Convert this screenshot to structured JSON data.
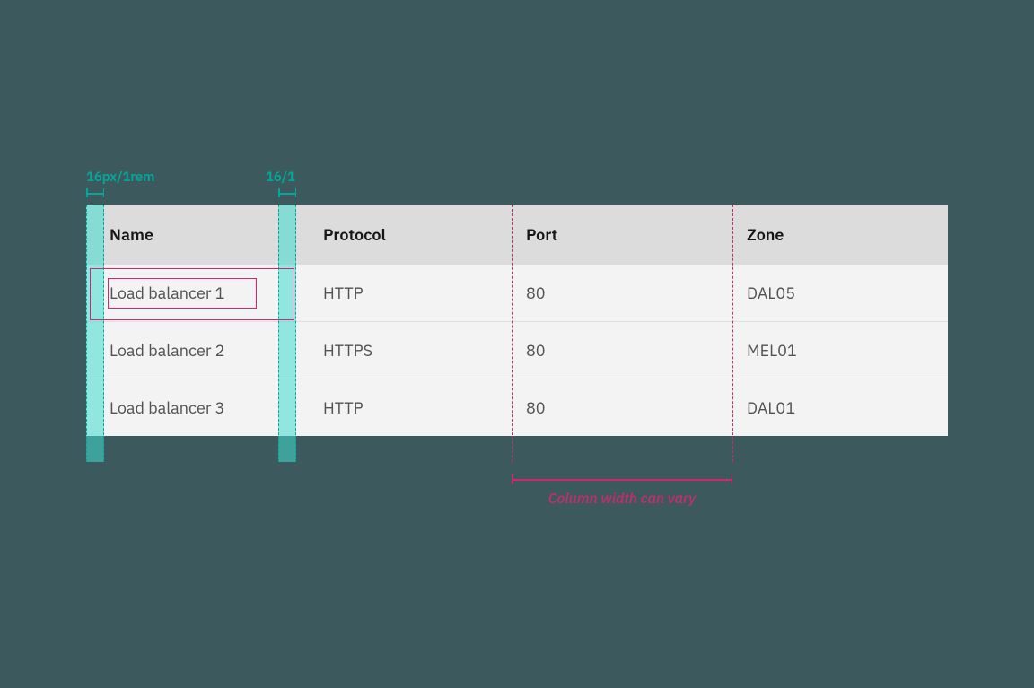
{
  "annotations": {
    "leftPadLabel": "16px/1rem",
    "rightPadLabel": "16/1",
    "widthNote": "Column width can vary"
  },
  "table": {
    "headers": {
      "name": "Name",
      "protocol": "Protocol",
      "port": "Port",
      "zone": "Zone"
    },
    "rows": [
      {
        "name": "Load balancer 1",
        "protocol": "HTTP",
        "port": "80",
        "zone": "DAL05"
      },
      {
        "name": "Load balancer 2",
        "protocol": "HTTPS",
        "port": "80",
        "zone": "MEL01"
      },
      {
        "name": "Load balancer 3",
        "protocol": "HTTP",
        "port": "80",
        "zone": "DAL01"
      }
    ]
  }
}
